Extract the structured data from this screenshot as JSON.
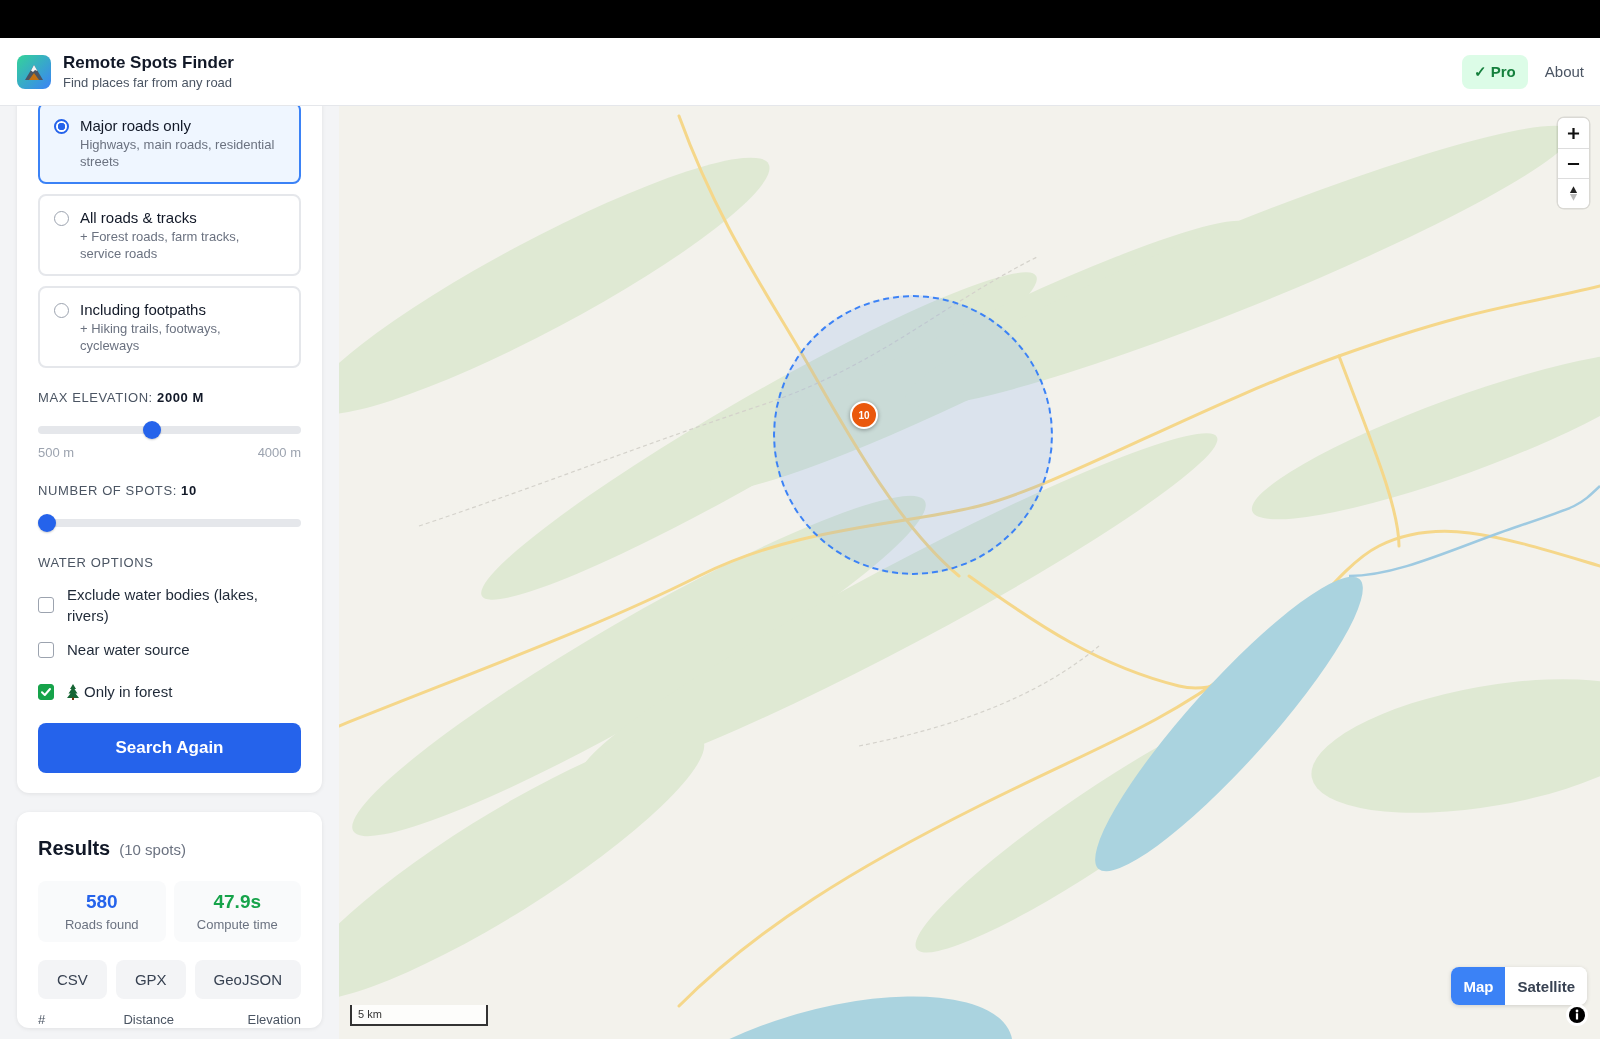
{
  "header": {
    "title": "Remote Spots Finder",
    "subtitle": "Find places far from any road",
    "pro_badge": "✓ Pro",
    "about_link": "About"
  },
  "road_options": [
    {
      "title": "Major roads only",
      "description": "Highways, main roads, residential streets",
      "selected": true
    },
    {
      "title": "All roads & tracks",
      "description": "+ Forest roads, farm tracks, service roads",
      "selected": false
    },
    {
      "title": "Including footpaths",
      "description": "+ Hiking trails, footways, cycleways",
      "selected": false
    }
  ],
  "elevation": {
    "label": "MAX ELEVATION: **2000 M**",
    "level": 0.43,
    "min_label": "500 m",
    "max_label": "4000 m"
  },
  "spots": {
    "label": "NUMBER OF SPOTS: **10**",
    "level": 0
  },
  "water_options": {
    "heading": "WATER OPTIONS",
    "items": [
      {
        "kind": "plain",
        "label": "Exclude water bodies (lakes, rivers)",
        "checked": false
      },
      {
        "kind": "plain",
        "label": "Near water source",
        "checked": false
      },
      {
        "kind": "forest",
        "label": "Only in forest",
        "checked": true
      }
    ]
  },
  "search_button": "Search Again",
  "results": {
    "title": "Results",
    "count": "(10 spots)",
    "stats": [
      {
        "value": "580",
        "label": "Roads found",
        "color": "#2563eb"
      },
      {
        "value": "47.9s",
        "label": "Compute time",
        "color": "#16a34a"
      }
    ],
    "exports": [
      "CSV",
      "GPX",
      "GeoJSON"
    ],
    "columns": [
      "#",
      "Distance",
      "Elevation"
    ]
  },
  "map": {
    "cluster_marker": "10",
    "scale": "5 km",
    "layers": [
      {
        "label": "Map",
        "selected": true
      },
      {
        "label": "Satellite",
        "selected": false
      }
    ]
  }
}
